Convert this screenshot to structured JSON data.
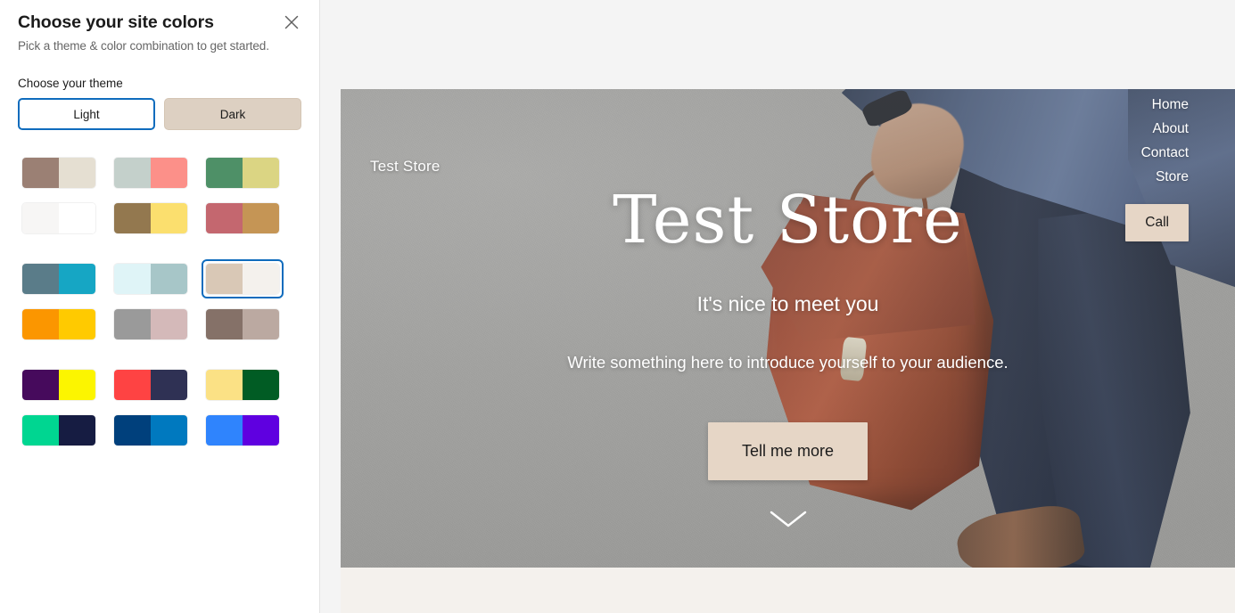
{
  "panel": {
    "title": "Choose your site colors",
    "subtitle": "Pick a theme & color combination to get started.",
    "close_label": "close-icon",
    "theme_section_label": "Choose your theme",
    "themes": [
      {
        "label": "Light",
        "selected": true
      },
      {
        "label": "Dark",
        "selected": false
      }
    ],
    "accent_color": "#0f6cbd",
    "swatch_groups": [
      {
        "rows": [
          [
            {
              "name": "taupe-cream",
              "left": "#9b8074",
              "right": "#e5dfd2",
              "selected": false
            },
            {
              "name": "sage-coral",
              "left": "#c4d0cb",
              "right": "#fc9089",
              "selected": false
            },
            {
              "name": "green-olive",
              "left": "#4e9067",
              "right": "#dbd583",
              "selected": false
            }
          ],
          [
            {
              "name": "offwhite-white",
              "left": "#f7f6f5",
              "right": "#ffffff",
              "selected": false
            },
            {
              "name": "bronze-yellow",
              "left": "#93784f",
              "right": "#fbdf6e",
              "selected": false
            },
            {
              "name": "rose-camel",
              "left": "#c4676f",
              "right": "#c59555",
              "selected": false
            }
          ]
        ]
      },
      {
        "rows": [
          [
            {
              "name": "slate-teal",
              "left": "#5a7c89",
              "right": "#16a6c4",
              "selected": false
            },
            {
              "name": "icewater-steel",
              "left": "#dff4f7",
              "right": "#a7c6c8",
              "selected": false
            },
            {
              "name": "beige-linen",
              "left": "#d9c8b6",
              "right": "#f4f1ed",
              "selected": true
            }
          ],
          [
            {
              "name": "orange-gold",
              "left": "#fb9600",
              "right": "#ffca00",
              "selected": false
            },
            {
              "name": "gray-blush",
              "left": "#9a9a9a",
              "right": "#d4b9b9",
              "selected": false
            },
            {
              "name": "mocha-mauve",
              "left": "#857168",
              "right": "#bba9a1",
              "selected": false
            }
          ]
        ]
      },
      {
        "rows": [
          [
            {
              "name": "purple-yellow",
              "left": "#460a5c",
              "right": "#fcf500",
              "selected": false
            },
            {
              "name": "red-navy",
              "left": "#fe4343",
              "right": "#2f3154",
              "selected": false
            },
            {
              "name": "butter-forest",
              "left": "#fbe185",
              "right": "#015c24",
              "selected": false
            }
          ],
          [
            {
              "name": "mint-midnight",
              "left": "#00d691",
              "right": "#161c42",
              "selected": false
            },
            {
              "name": "navy-azure",
              "left": "#00407c",
              "right": "#0079bf",
              "selected": false
            },
            {
              "name": "blue-violet",
              "left": "#2f84fd",
              "right": "#5f00e0",
              "selected": false
            }
          ]
        ]
      }
    ]
  },
  "preview": {
    "site_brand": "Test Store",
    "nav_items": [
      "Home",
      "About",
      "Contact",
      "Store"
    ],
    "call_button": "Call",
    "hero_title": "Test Store",
    "hero_tagline": "It's nice to meet you",
    "hero_description": "Write something here to introduce yourself to your audience.",
    "cta_button": "Tell me more",
    "scroll_icon": "chevron-down-icon",
    "button_color": "#e6d6c6",
    "next_section_color": "#f4f1ed"
  }
}
